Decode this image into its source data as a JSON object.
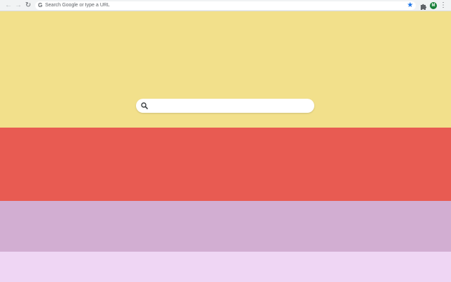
{
  "browser": {
    "omnibox_placeholder": "Search Google or type a URL",
    "google_icon": "G",
    "back_icon": "←",
    "forward_icon": "→",
    "reload_icon": "↻",
    "star_icon": "★",
    "menu_icon": "⋮",
    "avatar_letter": "M",
    "accent_color": "#1a73e8",
    "avatar_color": "#188038"
  },
  "page": {
    "bands": [
      {
        "color": "#f2e08b"
      },
      {
        "color": "#e85b52"
      },
      {
        "color": "#d2aed2"
      },
      {
        "color": "#efd6f4"
      }
    ],
    "search": {
      "value": "",
      "placeholder": "",
      "icon": "search-icon"
    }
  }
}
